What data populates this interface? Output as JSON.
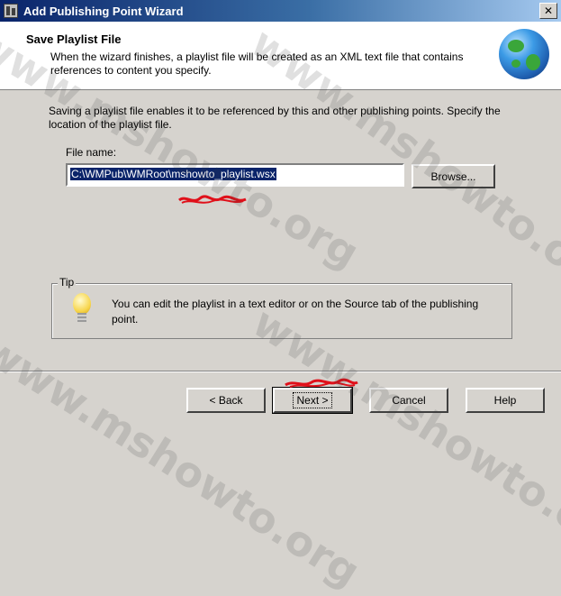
{
  "window": {
    "title": "Add Publishing Point Wizard",
    "close_glyph": "✕"
  },
  "header": {
    "title": "Save Playlist File",
    "description": "When the wizard finishes, a playlist file will be created as an XML text file that contains references to content you specify.",
    "icon": "globe-icon"
  },
  "main": {
    "intro": "Saving a playlist file enables it to be referenced by this and other publishing points. Specify the location of the playlist file.",
    "file_name_label": "File name:",
    "file_name_value": "C:\\WMPub\\WMRoot\\mshowto_playlist.wsx",
    "browse_label": "Browse..."
  },
  "tip": {
    "legend": "Tip",
    "text": "You can edit the playlist in a text editor or on the Source tab of the publishing point.",
    "icon": "lightbulb-icon"
  },
  "footer": {
    "back_label": "< Back",
    "next_label": "Next >",
    "cancel_label": "Cancel",
    "help_label": "Help"
  },
  "watermark": {
    "text": "www.mshowto.org"
  },
  "colors": {
    "dialog_bg": "#d6d3ce",
    "title_bar": "#0a246a",
    "selection": "#0a246a",
    "scribble": "#e0101a"
  }
}
